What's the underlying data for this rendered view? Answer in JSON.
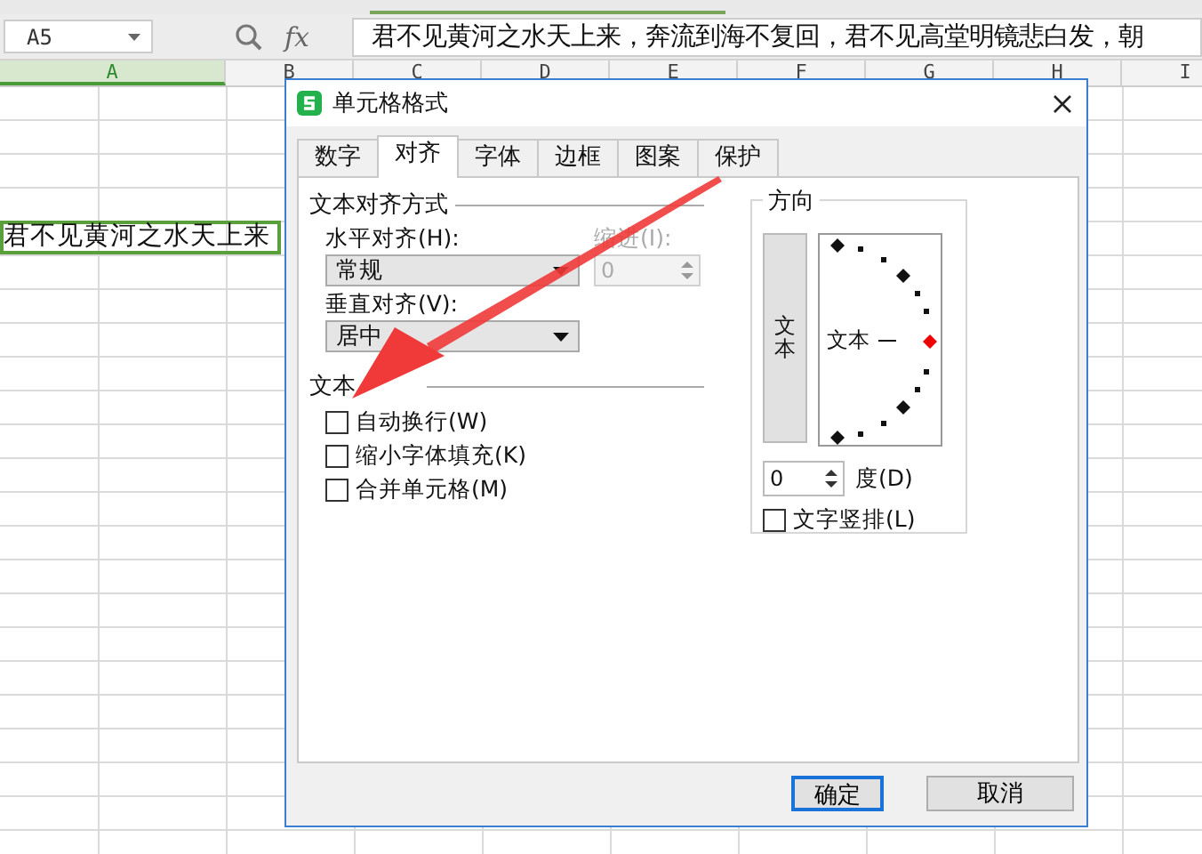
{
  "formula_bar": {
    "name_box": "A5",
    "fx_label": "fx",
    "formula": "君不见黄河之水天上来，奔流到海不复回，君不见高堂明镜悲白发，朝"
  },
  "columns": [
    {
      "label": "A",
      "selected": true
    },
    {
      "label": "B",
      "selected": false
    },
    {
      "label": "C",
      "selected": false
    },
    {
      "label": "D",
      "selected": false
    },
    {
      "label": "E",
      "selected": false
    },
    {
      "label": "F",
      "selected": false
    },
    {
      "label": "G",
      "selected": false
    },
    {
      "label": "H",
      "selected": false
    },
    {
      "label": "I",
      "selected": false
    }
  ],
  "active_cell": {
    "text": "君不见黄河之水天上来"
  },
  "dialog": {
    "title": "单元格格式",
    "tabs": [
      {
        "label": "数字",
        "selected": false
      },
      {
        "label": "对齐",
        "selected": true
      },
      {
        "label": "字体",
        "selected": false
      },
      {
        "label": "边框",
        "selected": false
      },
      {
        "label": "图案",
        "selected": false
      },
      {
        "label": "保护",
        "selected": false
      }
    ],
    "alignment": {
      "legend": "文本对齐方式",
      "horizontal_label": "水平对齐(H):",
      "horizontal_value": "常规",
      "indent_label": "缩进(I):",
      "indent_value": "0",
      "indent_disabled": true,
      "vertical_label": "垂直对齐(V):",
      "vertical_value": "居中"
    },
    "text_control": {
      "legend": "文本",
      "options": [
        {
          "label": "自动换行(W)",
          "checked": false
        },
        {
          "label": "缩小字体填充(K)",
          "checked": false
        },
        {
          "label": "合并单元格(M)",
          "checked": false
        }
      ]
    },
    "orientation": {
      "legend": "方向",
      "vertical_text": "文本",
      "dial_text": "文本",
      "degrees": "0",
      "degree_label": "度(D)",
      "vertical_option": {
        "label": "文字竖排(L)",
        "checked": false
      }
    },
    "buttons": [
      {
        "label": "确定",
        "default": true
      },
      {
        "label": "取消",
        "default": false
      }
    ]
  }
}
